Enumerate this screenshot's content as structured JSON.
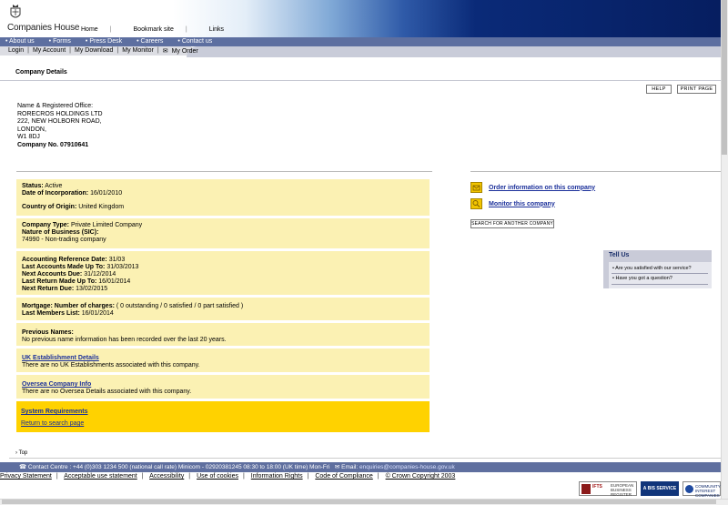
{
  "header": {
    "logo_text": "Companies House",
    "top_links": [
      "Home",
      "Bookmark site",
      "Links"
    ]
  },
  "nav1": [
    "About us",
    "Forms",
    "Press Desk",
    "Careers",
    "Contact us"
  ],
  "nav2": [
    "Login",
    "My Account",
    "My Download",
    "My Monitor",
    "My Order"
  ],
  "page": {
    "subtitle": "Company Details",
    "help_label": "HELP",
    "print_label": "PRINT PAGE"
  },
  "address": {
    "label": "Name & Registered Office:",
    "name": "RORECROS HOLDINGS LTD",
    "line1": "222, NEW HOLBORN ROAD,",
    "line2": "LONDON,",
    "postcode": "W1 8DJ",
    "company_no": "Company No. 07910641"
  },
  "details": {
    "status_label": "Status:",
    "status_value": "Active",
    "inc_label": "Date of Incorporation:",
    "inc_value": "16/01/2010",
    "origin_label": "Country of Origin:",
    "origin_value": "United Kingdom",
    "type_label": "Company Type:",
    "type_value": "Private Limited Company",
    "sic_label": "Nature of Business (SIC):",
    "sic_value": "74990 - Non-trading company",
    "ard_label": "Accounting Reference Date:",
    "ard_value": "31/03",
    "lamu_label": "Last Accounts Made Up To:",
    "lamu_value": "31/03/2013",
    "nad_label": "Next Accounts Due:",
    "nad_value": "31/12/2014",
    "lrmu_label": "Last Return Made Up To:",
    "lrmu_value": "16/01/2014",
    "nrd_label": "Next Return Due:",
    "nrd_value": "13/02/2015",
    "mort_label": "Mortgage:",
    "mort_charges_label": "Number of charges:",
    "mort_value": "( 0 outstanding / 0 satisfied / 0 part satisfied )",
    "lml_label": "Last Members List:",
    "lml_value": "16/01/2014",
    "prev_label": "Previous Names:",
    "prev_value": "No previous name information has been recorded over the last 20 years.",
    "uk_link": "UK Establishment Details",
    "uk_value": "There are no UK Establishments associated with this company.",
    "os_link": "Oversea Company Info",
    "os_value": "There are no Oversea Details associated with this company.",
    "sysreq": "System Requirements",
    "return_link": "Return to search page"
  },
  "actions": {
    "order_label": "Order information on this company",
    "monitor_label": "Monitor this company",
    "search_label": "SEARCH FOR ANOTHER COMPANY"
  },
  "tellus": {
    "title": "Tell Us",
    "items": [
      "Are you satisfied with our service?",
      "Have you got a question?"
    ]
  },
  "footer": {
    "top_label": "Top",
    "contact": "Contact Centre : +44 (0)303 1234 500 (national call rate)   Minicom - 02920381245 08:30 to 18:00 (UK time) Mon-Fri",
    "email_label": "Email:",
    "email_value": "enquiries@companies-house.gov.uk",
    "links": [
      "Privacy Statement",
      "Acceptable use statement",
      "Accessibility",
      "Use of cookies",
      "Information Rights",
      "Code of Compliance",
      "© Crown Copyright 2003"
    ],
    "badges": {
      "ifts_mark": "IFTS",
      "ifts_text": "EUROPEAN BUSINESS REGISTER",
      "bis": "A BIS SERVICE",
      "cic": "COMMUNITY INTEREST COMPANIES"
    }
  }
}
